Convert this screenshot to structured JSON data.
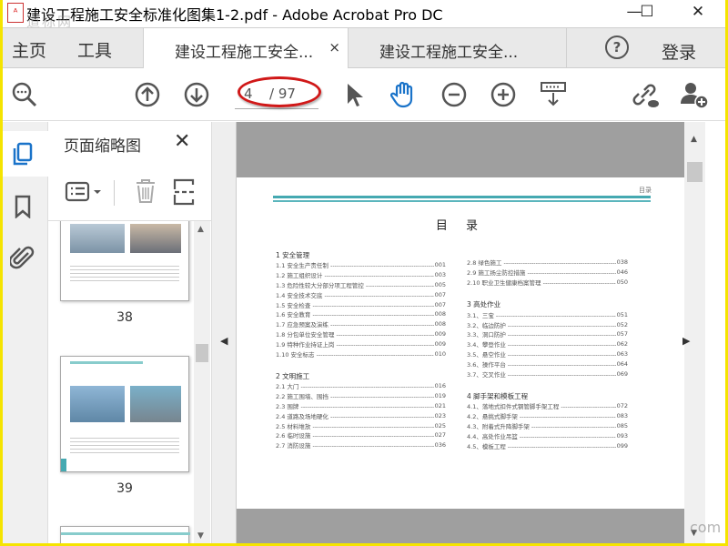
{
  "window": {
    "title": "建设工程施工安全标准化图集1-2.pdf - Adobe Acrobat Pro DC",
    "minimize": "—",
    "maximize": "☐",
    "close": "✕"
  },
  "watermark": {
    "top": "道标网",
    "bottom": "com"
  },
  "tabs": {
    "home": "主页",
    "tools": "工具",
    "doc_active": "建设工程施工安全...",
    "doc_inactive": "建设工程施工安全...",
    "close": "×",
    "help": "?",
    "login": "登录"
  },
  "toolbar": {
    "current_page": "4",
    "total_pages": "/ 97"
  },
  "panel": {
    "title": "页面缩略图",
    "close": "✕",
    "thumbs": [
      {
        "label": "38"
      },
      {
        "label": "39"
      }
    ]
  },
  "page": {
    "header": "目录",
    "title": "目 录",
    "left": [
      {
        "section": "1 安全管理",
        "items": [
          [
            "1.1 安全生产责任制",
            "001"
          ],
          [
            "1.2 施工组织设计",
            "003"
          ],
          [
            "1.3 危险性较大分部分项工程管控",
            "005"
          ],
          [
            "1.4 安全技术交底",
            "007"
          ],
          [
            "1.5 安全检查",
            "007"
          ],
          [
            "1.6 安全教育",
            "008"
          ],
          [
            "1.7 应急预案及演练",
            "008"
          ],
          [
            "1.8 分包单位安全管理",
            "009"
          ],
          [
            "1.9 特种作业持证上岗",
            "009"
          ],
          [
            "1.10 安全标志",
            "010"
          ]
        ]
      },
      {
        "section": "2 文明施工",
        "items": [
          [
            "2.1 大门",
            "016"
          ],
          [
            "2.2 施工围墙、围挡",
            "019"
          ],
          [
            "2.3 围牌",
            "021"
          ],
          [
            "2.4 道路及场地硬化",
            "023"
          ],
          [
            "2.5 材料堆放",
            "025"
          ],
          [
            "2.6 临时设施",
            "027"
          ],
          [
            "2.7 消防设施",
            "036"
          ]
        ]
      }
    ],
    "right": [
      {
        "section": "",
        "items": [
          [
            "2.8 绿色施工",
            "038"
          ],
          [
            "2.9 施工扬尘防控措施",
            "046"
          ],
          [
            "2.10 职业卫生健康档案管理",
            "050"
          ]
        ]
      },
      {
        "section": "3 高处作业",
        "items": [
          [
            "3.1、三宝",
            "051"
          ],
          [
            "3.2、临边防护",
            "052"
          ],
          [
            "3.3、洞口防护",
            "057"
          ],
          [
            "3.4、攀登作业",
            "062"
          ],
          [
            "3.5、悬空作业",
            "063"
          ],
          [
            "3.6、操作平台",
            "064"
          ],
          [
            "3.7、交叉作业",
            "069"
          ]
        ]
      },
      {
        "section": "4 脚手架和模板工程",
        "items": [
          [
            "4.1、落地式扣件式钢管脚手架工程",
            "072"
          ],
          [
            "4.2、悬挑式脚手架",
            "083"
          ],
          [
            "4.3、附着式升降脚手架",
            "085"
          ],
          [
            "4.4、高处作业吊篮",
            "093"
          ],
          [
            "4.5、模板工程",
            "099"
          ]
        ]
      }
    ]
  }
}
